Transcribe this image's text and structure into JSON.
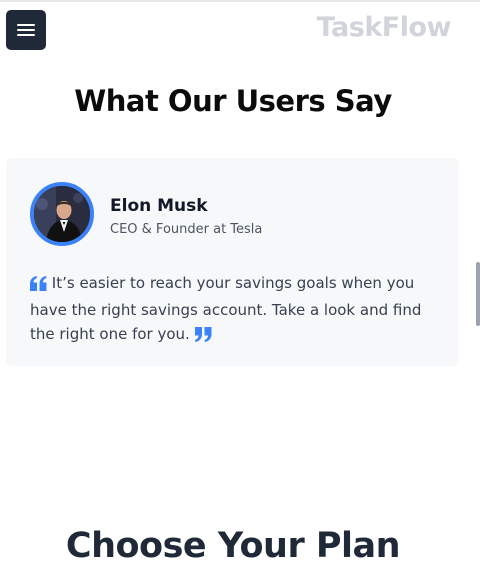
{
  "header": {
    "brand": "TaskFlow",
    "menu_icon": "hamburger-menu-icon"
  },
  "testimonials": {
    "title": "What Our Users Say",
    "items": [
      {
        "name": "Elon Musk",
        "role": "CEO & Founder at Tesla",
        "quote": "It’s easier to reach your savings goals when you have the right savings account. Take a look and find the right one for you.",
        "open_quote_icon": "quote-open-icon",
        "close_quote_icon": "quote-close-icon"
      }
    ]
  },
  "pricing": {
    "title": "Choose Your Plan"
  },
  "colors": {
    "accent": "#3b82f6",
    "menu_bg": "#1f2937",
    "brand_text": "#d1d5db",
    "card_bg": "#f7f8fa"
  }
}
